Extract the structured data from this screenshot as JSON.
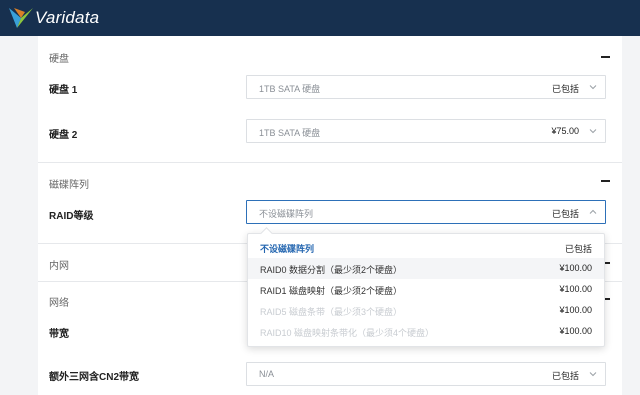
{
  "brand": {
    "name": "Varidata"
  },
  "sections": {
    "disk": {
      "title": "硬盘"
    },
    "raid": {
      "title": "磁碟阵列"
    },
    "intranet": {
      "title": "内网"
    },
    "network": {
      "title": "网络"
    }
  },
  "rows": {
    "disk1": {
      "label": "硬盘 1",
      "value": "1TB SATA 硬盘",
      "price": "已包括"
    },
    "disk2": {
      "label": "硬盘 2",
      "value": "1TB SATA 硬盘",
      "price": "¥75.00"
    },
    "raid": {
      "label": "RAID等级",
      "value": "不设磁碟阵列",
      "price": "已包括"
    },
    "bandwidth": {
      "label": "带宽"
    },
    "cn2": {
      "label": "额外三网含CN2带宽",
      "value": "N/A",
      "price": "已包括"
    }
  },
  "raid_options": [
    {
      "label": "不设磁碟阵列",
      "price": "已包括",
      "state": "selected"
    },
    {
      "label": "RAID0 数据分割（最少须2个硬盘）",
      "price": "¥100.00",
      "state": "highlighted"
    },
    {
      "label": "RAID1 磁盘映射（最少须2个硬盘）",
      "price": "¥100.00",
      "state": "normal"
    },
    {
      "label": "RAID5 磁盘条带（最少须3个硬盘）",
      "price": "¥100.00",
      "state": "faded"
    },
    {
      "label": "RAID10 磁盘映射条带化（最少须4个硬盘）",
      "price": "¥100.00",
      "state": "faded"
    }
  ],
  "colors": {
    "topbar": "#17304f",
    "accent": "#2466b0",
    "logo_blue": "#3aa0d8",
    "logo_green": "#8cc63f"
  }
}
